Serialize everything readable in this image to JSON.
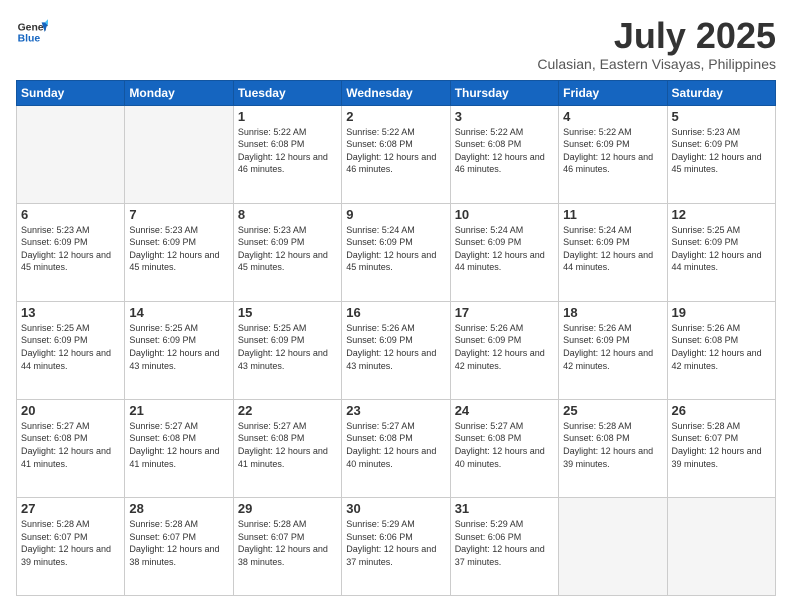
{
  "logo": {
    "line1": "General",
    "line2": "Blue"
  },
  "title": "July 2025",
  "subtitle": "Culasian, Eastern Visayas, Philippines",
  "days_of_week": [
    "Sunday",
    "Monday",
    "Tuesday",
    "Wednesday",
    "Thursday",
    "Friday",
    "Saturday"
  ],
  "weeks": [
    [
      {
        "day": "",
        "info": ""
      },
      {
        "day": "",
        "info": ""
      },
      {
        "day": "1",
        "info": "Sunrise: 5:22 AM\nSunset: 6:08 PM\nDaylight: 12 hours and 46 minutes."
      },
      {
        "day": "2",
        "info": "Sunrise: 5:22 AM\nSunset: 6:08 PM\nDaylight: 12 hours and 46 minutes."
      },
      {
        "day": "3",
        "info": "Sunrise: 5:22 AM\nSunset: 6:08 PM\nDaylight: 12 hours and 46 minutes."
      },
      {
        "day": "4",
        "info": "Sunrise: 5:22 AM\nSunset: 6:09 PM\nDaylight: 12 hours and 46 minutes."
      },
      {
        "day": "5",
        "info": "Sunrise: 5:23 AM\nSunset: 6:09 PM\nDaylight: 12 hours and 45 minutes."
      }
    ],
    [
      {
        "day": "6",
        "info": "Sunrise: 5:23 AM\nSunset: 6:09 PM\nDaylight: 12 hours and 45 minutes."
      },
      {
        "day": "7",
        "info": "Sunrise: 5:23 AM\nSunset: 6:09 PM\nDaylight: 12 hours and 45 minutes."
      },
      {
        "day": "8",
        "info": "Sunrise: 5:23 AM\nSunset: 6:09 PM\nDaylight: 12 hours and 45 minutes."
      },
      {
        "day": "9",
        "info": "Sunrise: 5:24 AM\nSunset: 6:09 PM\nDaylight: 12 hours and 45 minutes."
      },
      {
        "day": "10",
        "info": "Sunrise: 5:24 AM\nSunset: 6:09 PM\nDaylight: 12 hours and 44 minutes."
      },
      {
        "day": "11",
        "info": "Sunrise: 5:24 AM\nSunset: 6:09 PM\nDaylight: 12 hours and 44 minutes."
      },
      {
        "day": "12",
        "info": "Sunrise: 5:25 AM\nSunset: 6:09 PM\nDaylight: 12 hours and 44 minutes."
      }
    ],
    [
      {
        "day": "13",
        "info": "Sunrise: 5:25 AM\nSunset: 6:09 PM\nDaylight: 12 hours and 44 minutes."
      },
      {
        "day": "14",
        "info": "Sunrise: 5:25 AM\nSunset: 6:09 PM\nDaylight: 12 hours and 43 minutes."
      },
      {
        "day": "15",
        "info": "Sunrise: 5:25 AM\nSunset: 6:09 PM\nDaylight: 12 hours and 43 minutes."
      },
      {
        "day": "16",
        "info": "Sunrise: 5:26 AM\nSunset: 6:09 PM\nDaylight: 12 hours and 43 minutes."
      },
      {
        "day": "17",
        "info": "Sunrise: 5:26 AM\nSunset: 6:09 PM\nDaylight: 12 hours and 42 minutes."
      },
      {
        "day": "18",
        "info": "Sunrise: 5:26 AM\nSunset: 6:09 PM\nDaylight: 12 hours and 42 minutes."
      },
      {
        "day": "19",
        "info": "Sunrise: 5:26 AM\nSunset: 6:08 PM\nDaylight: 12 hours and 42 minutes."
      }
    ],
    [
      {
        "day": "20",
        "info": "Sunrise: 5:27 AM\nSunset: 6:08 PM\nDaylight: 12 hours and 41 minutes."
      },
      {
        "day": "21",
        "info": "Sunrise: 5:27 AM\nSunset: 6:08 PM\nDaylight: 12 hours and 41 minutes."
      },
      {
        "day": "22",
        "info": "Sunrise: 5:27 AM\nSunset: 6:08 PM\nDaylight: 12 hours and 41 minutes."
      },
      {
        "day": "23",
        "info": "Sunrise: 5:27 AM\nSunset: 6:08 PM\nDaylight: 12 hours and 40 minutes."
      },
      {
        "day": "24",
        "info": "Sunrise: 5:27 AM\nSunset: 6:08 PM\nDaylight: 12 hours and 40 minutes."
      },
      {
        "day": "25",
        "info": "Sunrise: 5:28 AM\nSunset: 6:08 PM\nDaylight: 12 hours and 39 minutes."
      },
      {
        "day": "26",
        "info": "Sunrise: 5:28 AM\nSunset: 6:07 PM\nDaylight: 12 hours and 39 minutes."
      }
    ],
    [
      {
        "day": "27",
        "info": "Sunrise: 5:28 AM\nSunset: 6:07 PM\nDaylight: 12 hours and 39 minutes."
      },
      {
        "day": "28",
        "info": "Sunrise: 5:28 AM\nSunset: 6:07 PM\nDaylight: 12 hours and 38 minutes."
      },
      {
        "day": "29",
        "info": "Sunrise: 5:28 AM\nSunset: 6:07 PM\nDaylight: 12 hours and 38 minutes."
      },
      {
        "day": "30",
        "info": "Sunrise: 5:29 AM\nSunset: 6:06 PM\nDaylight: 12 hours and 37 minutes."
      },
      {
        "day": "31",
        "info": "Sunrise: 5:29 AM\nSunset: 6:06 PM\nDaylight: 12 hours and 37 minutes."
      },
      {
        "day": "",
        "info": ""
      },
      {
        "day": "",
        "info": ""
      }
    ]
  ]
}
